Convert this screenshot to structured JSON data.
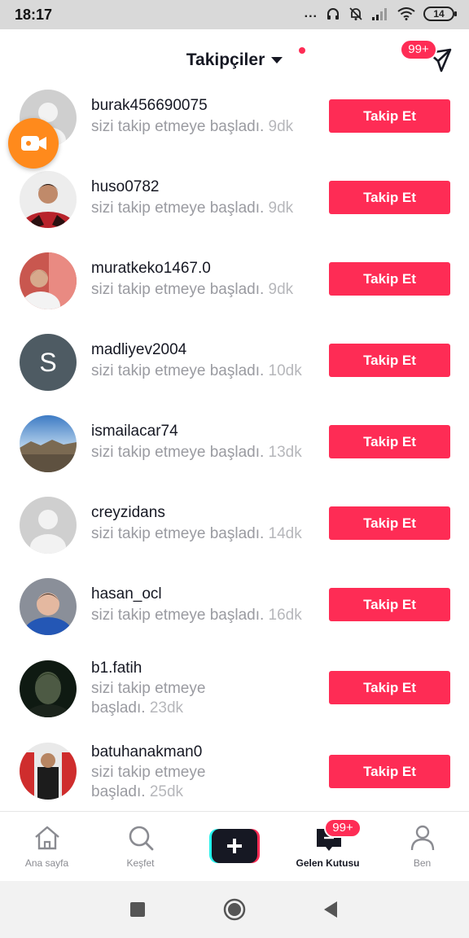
{
  "status_bar": {
    "time": "18:17",
    "dots": "...",
    "battery": "14"
  },
  "header": {
    "title": "Takipçiler",
    "dm_badge": "99+"
  },
  "followers": [
    {
      "username": "burak456690075",
      "text": "sizi takip etmeye başladı.",
      "time": "9dk",
      "button": "Takip Et"
    },
    {
      "username": "huso0782",
      "text": "sizi takip etmeye başladı.",
      "time": "9dk",
      "button": "Takip Et"
    },
    {
      "username": "muratkeko1467.0",
      "text": "sizi takip etmeye başladı.",
      "time": "9dk",
      "button": "Takip Et"
    },
    {
      "username": "madliyev2004",
      "text": "sizi takip etmeye başladı.",
      "time": "10dk",
      "button": "Takip Et",
      "avatar_letter": "S"
    },
    {
      "username": "ismailacar74",
      "text": "sizi takip etmeye başladı.",
      "time": "13dk",
      "button": "Takip Et"
    },
    {
      "username": "creyzidans",
      "text": "sizi takip etmeye başladı.",
      "time": "14dk",
      "button": "Takip Et"
    },
    {
      "username": "hasan_ocl",
      "text": "sizi takip etmeye başladı.",
      "time": "16dk",
      "button": "Takip Et"
    },
    {
      "username": "b1.fatih",
      "text_line1": "sizi takip etmeye",
      "text_line2": "başladı.",
      "time": "23dk",
      "button": "Takip Et"
    },
    {
      "username": "batuhanakman0",
      "text_line1": "sizi takip etmeye",
      "text_line2": "başladı.",
      "time": "25dk",
      "button": "Takip Et"
    }
  ],
  "bottom_nav": {
    "home": "Ana sayfa",
    "discover": "Keşfet",
    "inbox": "Gelen Kutusu",
    "inbox_badge": "99+",
    "me": "Ben"
  },
  "colors": {
    "accent": "#fe2c55",
    "live_button": "#ff8a1c",
    "primary_text": "#161823",
    "secondary_text": "#9a9ba1"
  },
  "icons": [
    "send-icon",
    "video-camera-icon",
    "home-icon",
    "search-icon",
    "plus-icon",
    "inbox-icon",
    "person-icon",
    "square-icon",
    "circle-icon",
    "back-triangle-icon",
    "headphones-icon",
    "bell-off-icon",
    "signal-icon",
    "wifi-icon",
    "battery-icon"
  ]
}
